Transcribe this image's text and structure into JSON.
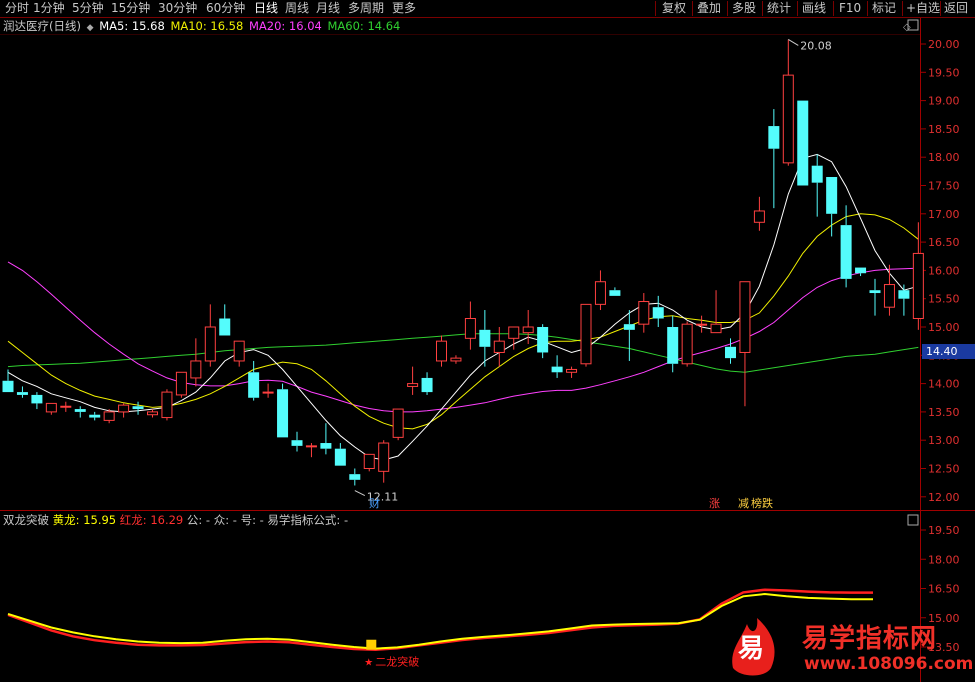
{
  "toolbar": {
    "left_tabs": [
      "分时",
      "1分钟",
      "5分钟",
      "15分钟",
      "30分钟",
      "60分钟",
      "日线",
      "周线",
      "月线",
      "多周期",
      "更多"
    ],
    "active_tab": "日线",
    "right_buttons": [
      "复权",
      "叠加",
      "多股",
      "统计",
      "画线",
      "F10",
      "标记",
      "+自选",
      "返回"
    ]
  },
  "main_info": {
    "title": "润达医疗(日线)",
    "ma5": "MA5: 15.68",
    "ma10": "MA10: 16.58",
    "ma20": "MA20: 16.04",
    "ma60": "MA60: 14.64"
  },
  "sub_info": {
    "title": "双龙突破",
    "huanglong_label": "黄龙:",
    "huanglong_value": "15.95",
    "honglong_label": "红龙:",
    "honglong_value": "16.29",
    "rest": "公: -  众: -  号: -  易学指标公式: -"
  },
  "annotations": {
    "high": "20.08",
    "low": "12.11",
    "cai": "财",
    "zhang": "涨",
    "jian": "减",
    "bang": "榜跌",
    "signal": "二龙突破",
    "current_price": "14.40"
  },
  "main_axis_ticks": [
    "20.00",
    "19.50",
    "19.00",
    "18.50",
    "18.00",
    "17.50",
    "17.00",
    "16.50",
    "16.00",
    "15.50",
    "15.00",
    "14.50",
    "14.00",
    "13.50",
    "13.00",
    "12.50",
    "12.00"
  ],
  "sub_axis_ticks": [
    "19.50",
    "18.00",
    "16.50",
    "15.00",
    "13.50"
  ],
  "watermark": {
    "icon_char": "易",
    "name": "易学指标网",
    "url": "www.108096.com"
  },
  "colors": {
    "up": "#ff4040",
    "down": "#54fcfc",
    "ma5": "#ffffff",
    "ma10": "#f0f000",
    "ma20": "#ff40ff",
    "ma60": "#30d030",
    "huanglong": "#ffff00",
    "honglong": "#ff2020"
  },
  "candles": [
    [
      14.05,
      14.25,
      13.85,
      13.85
    ],
    [
      13.85,
      13.95,
      13.75,
      13.8
    ],
    [
      13.8,
      13.85,
      13.55,
      13.65
    ],
    [
      13.5,
      13.65,
      13.45,
      13.65
    ],
    [
      13.6,
      13.68,
      13.5,
      13.6
    ],
    [
      13.55,
      13.6,
      13.4,
      13.5
    ],
    [
      13.45,
      13.5,
      13.35,
      13.4
    ],
    [
      13.35,
      13.55,
      13.3,
      13.5
    ],
    [
      13.5,
      13.65,
      13.4,
      13.62
    ],
    [
      13.6,
      13.68,
      13.45,
      13.55
    ],
    [
      13.45,
      13.55,
      13.4,
      13.5
    ],
    [
      13.4,
      13.9,
      13.35,
      13.85
    ],
    [
      13.8,
      14.2,
      13.75,
      14.2
    ],
    [
      14.1,
      14.8,
      13.95,
      14.4
    ],
    [
      14.4,
      15.4,
      14.3,
      15.0
    ],
    [
      15.15,
      15.4,
      14.85,
      14.85
    ],
    [
      14.4,
      14.75,
      14.3,
      14.75
    ],
    [
      14.2,
      14.4,
      13.7,
      13.75
    ],
    [
      13.85,
      14.0,
      13.75,
      13.85
    ],
    [
      13.9,
      14.0,
      13.05,
      13.05
    ],
    [
      13.0,
      13.15,
      12.8,
      12.9
    ],
    [
      12.9,
      12.95,
      12.7,
      12.9
    ],
    [
      12.95,
      13.3,
      12.75,
      12.85
    ],
    [
      12.85,
      12.95,
      12.55,
      12.55
    ],
    [
      12.4,
      12.5,
      12.2,
      12.3
    ],
    [
      12.5,
      12.75,
      12.45,
      12.75
    ],
    [
      12.45,
      13.0,
      12.25,
      12.95
    ],
    [
      13.05,
      13.55,
      13.0,
      13.55
    ],
    [
      13.95,
      14.3,
      13.8,
      14.0
    ],
    [
      14.1,
      14.2,
      13.8,
      13.85
    ],
    [
      14.4,
      14.85,
      14.3,
      14.75
    ],
    [
      14.4,
      14.5,
      14.35,
      14.45
    ],
    [
      14.8,
      15.45,
      14.6,
      15.15
    ],
    [
      14.95,
      15.3,
      14.3,
      14.65
    ],
    [
      14.55,
      15.0,
      14.3,
      14.75
    ],
    [
      14.8,
      15.0,
      14.6,
      15.0
    ],
    [
      14.9,
      15.3,
      14.7,
      15.0
    ],
    [
      15.0,
      15.05,
      14.45,
      14.55
    ],
    [
      14.3,
      14.5,
      14.1,
      14.2
    ],
    [
      14.2,
      14.3,
      14.1,
      14.25
    ],
    [
      14.35,
      15.4,
      14.3,
      15.4
    ],
    [
      15.4,
      16.0,
      15.3,
      15.8
    ],
    [
      15.65,
      15.7,
      15.55,
      15.55
    ],
    [
      15.05,
      15.3,
      14.4,
      14.95
    ],
    [
      15.05,
      15.6,
      14.9,
      15.45
    ],
    [
      15.35,
      15.55,
      15.0,
      15.15
    ],
    [
      15.0,
      15.2,
      14.2,
      14.35
    ],
    [
      14.35,
      15.1,
      14.3,
      15.05
    ],
    [
      15.05,
      15.2,
      14.9,
      15.05
    ],
    [
      14.9,
      15.65,
      14.9,
      15.05
    ],
    [
      14.65,
      14.8,
      14.35,
      14.45
    ],
    [
      14.55,
      15.8,
      13.6,
      15.8
    ],
    [
      16.85,
      17.3,
      16.7,
      17.05
    ],
    [
      18.55,
      18.85,
      17.1,
      18.15
    ],
    [
      17.9,
      20.08,
      17.85,
      19.45
    ],
    [
      19.0,
      19.0,
      17.5,
      17.5
    ],
    [
      17.85,
      18.05,
      16.95,
      17.55
    ],
    [
      17.65,
      17.65,
      16.6,
      17.0
    ],
    [
      16.8,
      17.15,
      15.7,
      15.85
    ],
    [
      16.05,
      16.05,
      15.9,
      15.95
    ],
    [
      15.65,
      15.85,
      15.2,
      15.6
    ],
    [
      15.35,
      16.1,
      15.2,
      15.75
    ],
    [
      15.65,
      15.75,
      15.2,
      15.5
    ],
    [
      15.15,
      16.85,
      14.95,
      16.3
    ]
  ],
  "ma5_line": [
    14.2,
    14.05,
    13.95,
    13.82,
    13.75,
    13.68,
    13.58,
    13.52,
    13.5,
    13.52,
    13.55,
    13.58,
    13.7,
    13.85,
    14.1,
    14.4,
    14.55,
    14.6,
    14.5,
    14.25,
    13.95,
    13.65,
    13.35,
    13.08,
    12.88,
    12.7,
    12.65,
    12.72,
    12.98,
    13.25,
    13.55,
    13.85,
    14.15,
    14.4,
    14.55,
    14.7,
    14.82,
    14.75,
    14.65,
    14.55,
    14.62,
    14.82,
    15.05,
    15.25,
    15.4,
    15.42,
    15.3,
    15.12,
    15.0,
    14.95,
    15.0,
    15.25,
    15.72,
    16.45,
    17.35,
    17.98,
    18.05,
    17.92,
    17.48,
    16.92,
    16.35,
    15.95,
    15.65,
    15.72
  ],
  "ma10_line": [
    14.75,
    14.55,
    14.35,
    14.15,
    14.0,
    13.88,
    13.78,
    13.72,
    13.66,
    13.62,
    13.58,
    13.6,
    13.65,
    13.72,
    13.82,
    13.95,
    14.1,
    14.25,
    14.32,
    14.38,
    14.35,
    14.25,
    14.05,
    13.82,
    13.6,
    13.42,
    13.3,
    13.22,
    13.2,
    13.28,
    13.45,
    13.68,
    13.9,
    14.12,
    14.3,
    14.48,
    14.62,
    14.72,
    14.75,
    14.75,
    14.78,
    14.82,
    14.92,
    15.02,
    15.12,
    15.18,
    15.2,
    15.15,
    15.12,
    15.08,
    15.08,
    15.12,
    15.25,
    15.55,
    15.9,
    16.3,
    16.6,
    16.8,
    16.95,
    17.0,
    16.98,
    16.9,
    16.75,
    16.55
  ],
  "ma20_line": [
    16.15,
    16.0,
    15.8,
    15.58,
    15.35,
    15.12,
    14.9,
    14.7,
    14.52,
    14.35,
    14.22,
    14.1,
    14.02,
    13.98,
    13.96,
    13.96,
    14.0,
    14.05,
    14.06,
    14.04,
    13.95,
    13.85,
    13.78,
    13.7,
    13.62,
    13.56,
    13.52,
    13.5,
    13.5,
    13.52,
    13.55,
    13.58,
    13.62,
    13.66,
    13.72,
    13.78,
    13.82,
    13.86,
    13.88,
    13.88,
    13.92,
    13.98,
    14.05,
    14.12,
    14.2,
    14.3,
    14.4,
    14.48,
    14.55,
    14.62,
    14.7,
    14.8,
    14.92,
    15.08,
    15.3,
    15.52,
    15.7,
    15.82,
    15.9,
    15.96,
    16.0,
    16.02,
    16.03,
    16.04
  ],
  "ma60_line": [
    14.3,
    14.32,
    14.33,
    14.34,
    14.35,
    14.36,
    14.38,
    14.4,
    14.42,
    14.44,
    14.46,
    14.48,
    14.5,
    14.52,
    14.55,
    14.58,
    14.6,
    14.62,
    14.64,
    14.65,
    14.66,
    14.67,
    14.68,
    14.7,
    14.72,
    14.74,
    14.76,
    14.78,
    14.8,
    14.82,
    14.84,
    14.86,
    14.88,
    14.88,
    14.88,
    14.88,
    14.87,
    14.85,
    14.82,
    14.78,
    14.74,
    14.7,
    14.66,
    14.62,
    14.56,
    14.5,
    14.44,
    14.38,
    14.32,
    14.26,
    14.22,
    14.2,
    14.24,
    14.28,
    14.32,
    14.36,
    14.4,
    14.44,
    14.48,
    14.5,
    14.52,
    14.56,
    14.6,
    14.64
  ],
  "huanglong_line": [
    15.2,
    14.85,
    14.5,
    14.25,
    14.05,
    13.9,
    13.78,
    13.72,
    13.7,
    13.72,
    13.82,
    13.9,
    13.92,
    13.88,
    13.75,
    13.62,
    13.5,
    13.42,
    13.48,
    13.62,
    13.78,
    13.92,
    14.02,
    14.1,
    14.2,
    14.3,
    14.45,
    14.6,
    14.65,
    14.68,
    14.7,
    14.72,
    14.9,
    15.6,
    16.1,
    16.22,
    16.1,
    16.02,
    15.98,
    15.95,
    15.95
  ],
  "honglong_line": [
    15.15,
    14.75,
    14.35,
    14.05,
    13.85,
    13.72,
    13.62,
    13.58,
    13.58,
    13.6,
    13.68,
    13.75,
    13.78,
    13.74,
    13.62,
    13.5,
    13.4,
    13.36,
    13.44,
    13.58,
    13.72,
    13.86,
    13.96,
    14.04,
    14.12,
    14.22,
    14.36,
    14.5,
    14.58,
    14.62,
    14.65,
    14.7,
    14.92,
    15.72,
    16.3,
    16.44,
    16.4,
    16.34,
    16.3,
    16.29,
    16.29
  ],
  "signal_position": 0.42
}
